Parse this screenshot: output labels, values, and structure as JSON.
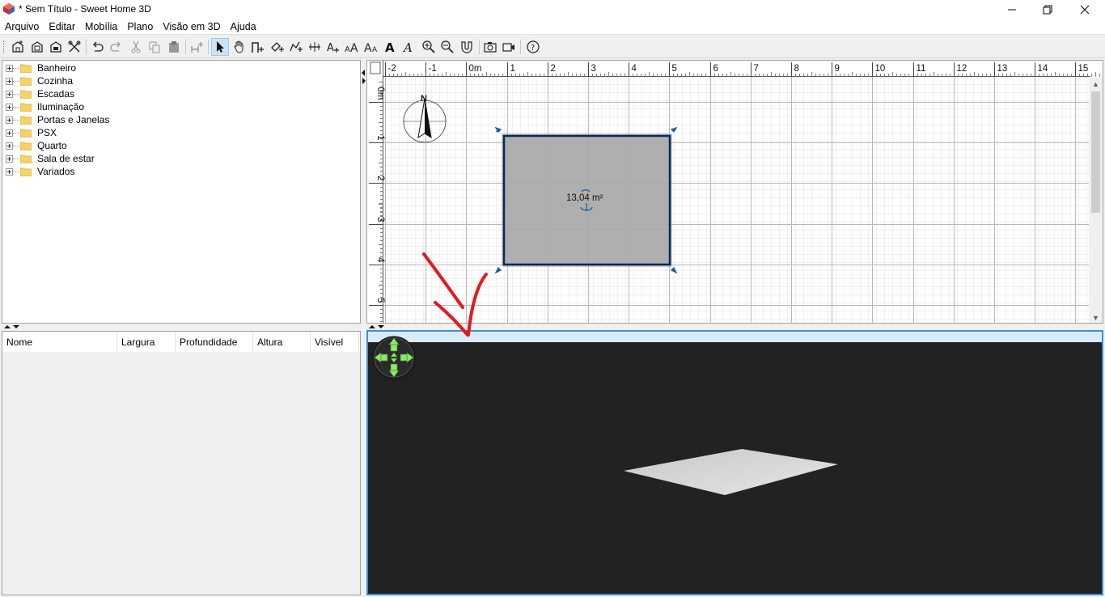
{
  "window": {
    "title": "* Sem Título - Sweet Home 3D"
  },
  "menu": [
    "Arquivo",
    "Editar",
    "Mobília",
    "Plano",
    "Visão em 3D",
    "Ajuda"
  ],
  "toolbar": {
    "icons": [
      "new-home-icon",
      "open-icon",
      "save-icon",
      "cut-tools-icon",
      "undo-icon",
      "redo-icon",
      "cut-icon",
      "copy-icon",
      "paste-icon",
      "add-furniture-icon",
      "select-mode-icon",
      "pan-mode-icon",
      "create-walls-icon",
      "create-rooms-icon",
      "create-polylines-icon",
      "create-dimensions-icon",
      "create-labels-icon",
      "increase-text-size-icon",
      "decrease-text-size-icon",
      "bold-text-icon",
      "italic-text-icon",
      "zoom-in-icon",
      "zoom-out-icon",
      "magnetism-icon",
      "create-photo-icon",
      "create-video-icon",
      "help-icon"
    ]
  },
  "catalog": {
    "categories": [
      "Banheiro",
      "Cozinha",
      "Escadas",
      "Iluminação",
      "Portas e Janelas",
      "PSX",
      "Quarto",
      "Sala de estar",
      "Variados"
    ]
  },
  "furniture_table": {
    "columns": [
      "Nome",
      "Largura",
      "Profundidade",
      "Altura",
      "Visível"
    ]
  },
  "plan": {
    "ruler_x": [
      "-2",
      "-1",
      "0m",
      "1",
      "2",
      "3",
      "4",
      "5",
      "6",
      "7",
      "8",
      "9",
      "10",
      "11",
      "12",
      "13",
      "14",
      "15"
    ],
    "ruler_y": [
      "0m",
      "1",
      "2",
      "3",
      "4",
      "5"
    ],
    "compass_label": "N",
    "room_area": "13,04 m²"
  },
  "colors": {
    "room_fill": "#a8a8a8",
    "room_border": "#0d2a4a",
    "selection": "#1f5f9f",
    "view3d_bg": "#222222",
    "annotation_arrow": "#e8171c",
    "navigator": "#8ee86e"
  }
}
